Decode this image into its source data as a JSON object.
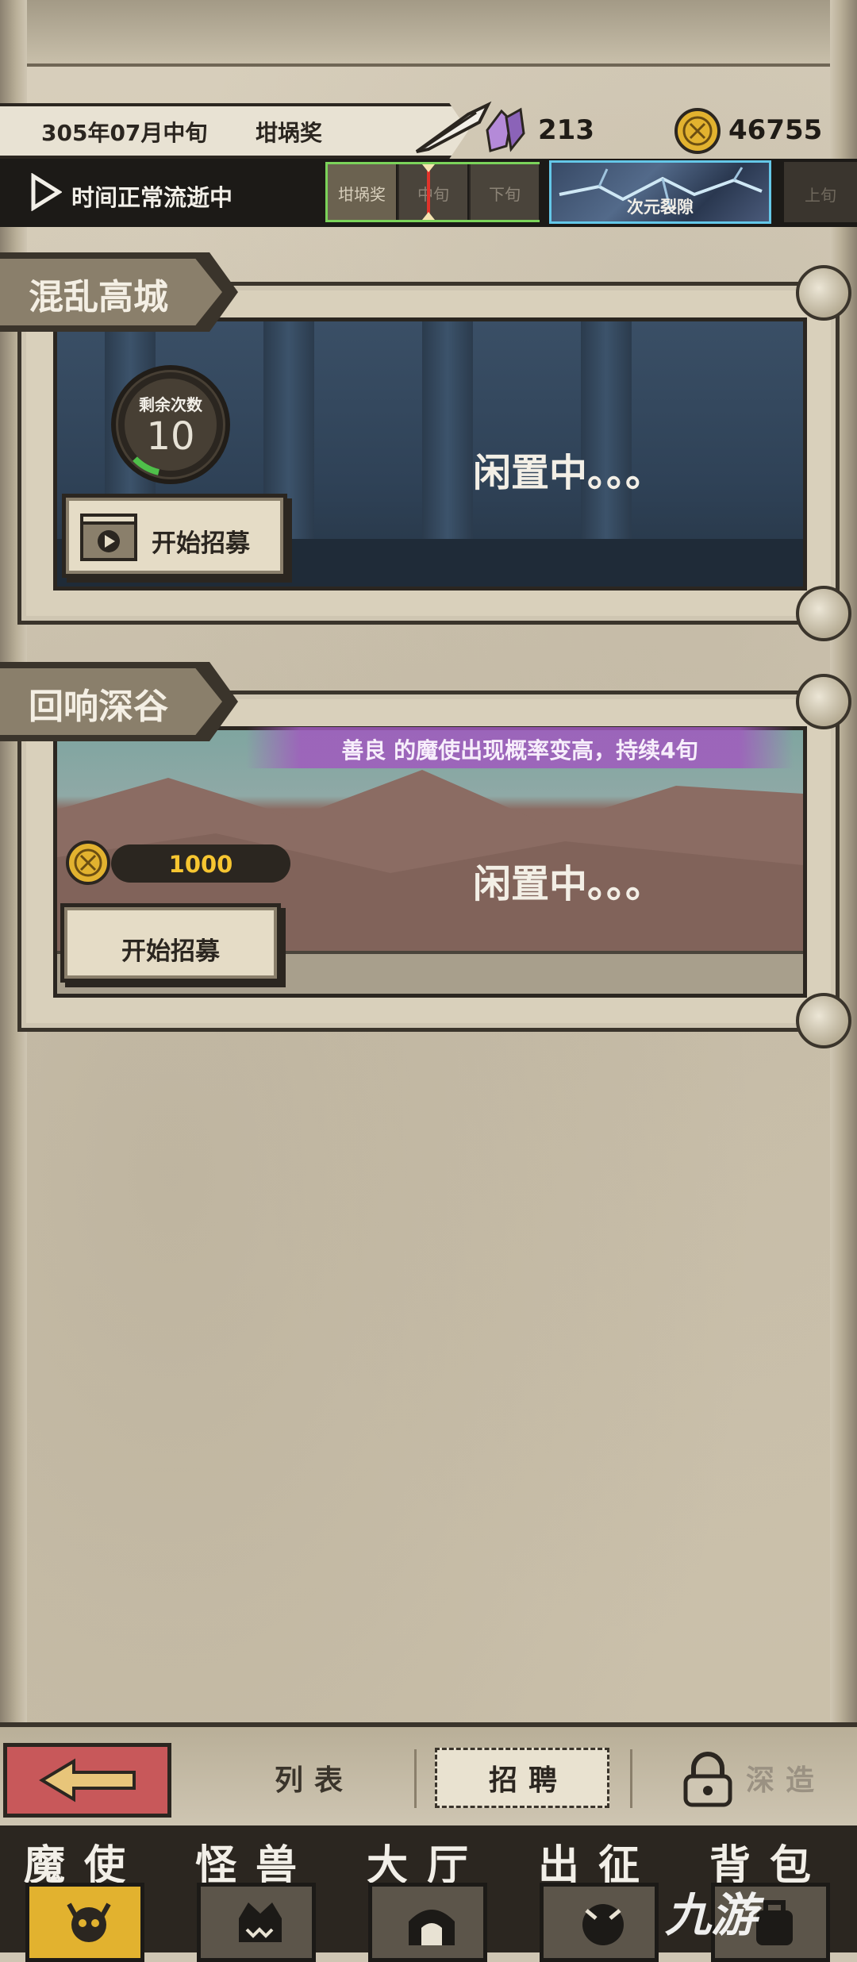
{
  "header": {
    "date": "305年07月中旬",
    "award": "坩埚奖",
    "crystals": "213",
    "gold": "46755",
    "time_status": "时间正常流逝中",
    "timeline": [
      "坩埚奖",
      "中旬",
      "下旬"
    ],
    "rift_label": "次元裂隙",
    "next_slot": "上旬"
  },
  "locations": [
    {
      "name": "混乱高城",
      "remaining_label": "剩余次数",
      "remaining_count": "10",
      "status": "闲置中。。。",
      "button": "开始招募"
    },
    {
      "name": "回响深谷",
      "buff": "善良 的魔使出现概率变高，持续4旬",
      "cost": "1000",
      "status": "闲置中。。。",
      "button": "开始招募"
    }
  ],
  "subtabs": {
    "list": "列表",
    "recruit": "招聘",
    "deep": "深造"
  },
  "nav": [
    "魔使",
    "怪兽",
    "大厅",
    "出征",
    "背包"
  ],
  "watermark": "九游",
  "colors": {
    "accent_gold": "#e2b22f",
    "back_button": "#c8585a",
    "buff_purple": "#a05abe",
    "timeline_green": "#7bd35a",
    "rift_blue": "#64c7e8"
  }
}
